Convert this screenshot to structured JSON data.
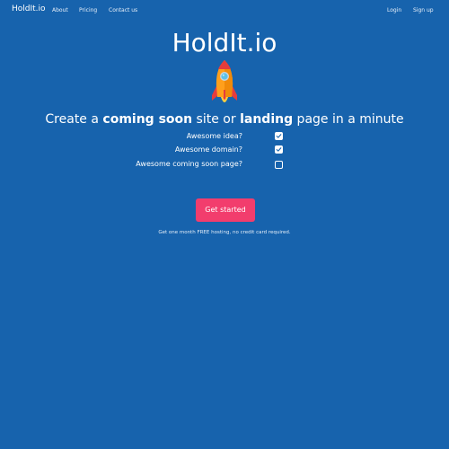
{
  "nav": {
    "brand": "HoldIt.io",
    "links": [
      "About",
      "Pricing",
      "Contact us"
    ],
    "login": "Login",
    "signup": "Sign up"
  },
  "hero": {
    "title": "HoldIt.io",
    "tagline": {
      "part1": "Create a ",
      "bold1": "coming soon",
      "part2": " site or ",
      "bold2": "landing",
      "part3": " page in a minute"
    },
    "rocket_icon": "rocket-icon"
  },
  "checklist": [
    {
      "label": "Awesome idea?",
      "checked": true
    },
    {
      "label": "Awesome domain?",
      "checked": true
    },
    {
      "label": "Awesome coming soon page?",
      "checked": false
    }
  ],
  "cta": {
    "label": "Get started",
    "note": "Get one month FREE hosting, no credit card required."
  },
  "colors": {
    "background": "#1763ad",
    "cta": "#f23d6d",
    "rocket_body": "#ff9f1c",
    "rocket_fin": "#e63c3c"
  }
}
